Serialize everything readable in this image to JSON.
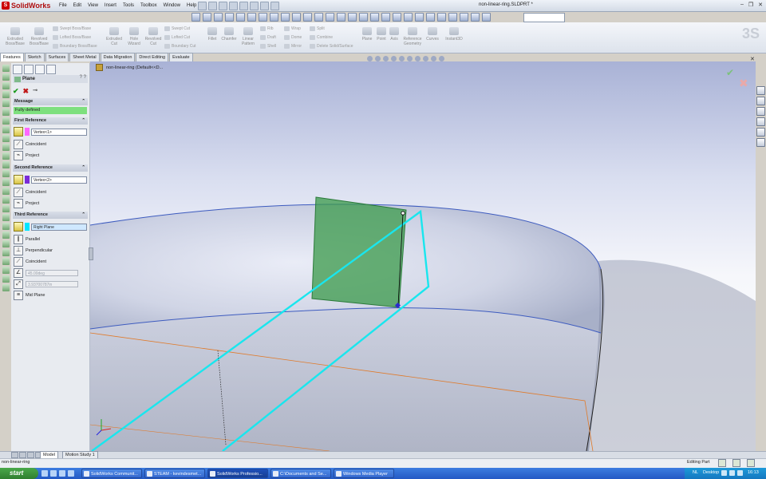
{
  "app": {
    "name": "SolidWorks",
    "doc_title": "non-linear-ring.SLDPRT *"
  },
  "menu": [
    "File",
    "Edit",
    "View",
    "Insert",
    "Tools",
    "Toolbox",
    "Window",
    "Help"
  ],
  "command_manager": {
    "large": [
      {
        "label": "Extruded Boss/Base"
      },
      {
        "label": "Revolved Boss/Base"
      },
      {
        "label": "Extruded Cut"
      },
      {
        "label": "Hole Wizard"
      },
      {
        "label": "Revolved Cut"
      },
      {
        "label": "Fillet"
      },
      {
        "label": "Chamfer"
      },
      {
        "label": "Linear Pattern"
      },
      {
        "label": "Plane"
      },
      {
        "label": "Point"
      },
      {
        "label": "Axis"
      },
      {
        "label": "Reference Geometry"
      },
      {
        "label": "Curves"
      },
      {
        "label": "Instant3D"
      }
    ],
    "small": [
      "Swept Boss/Base",
      "Lofted Boss/Base",
      "Boundary Boss/Base",
      "Swept Cut",
      "Lofted Cut",
      "Boundary Cut",
      "Rib",
      "Draft",
      "Shell",
      "Wrap",
      "Dome",
      "Mirror",
      "Split",
      "Combine",
      "Delete Solid/Surface"
    ]
  },
  "tabs": [
    "Features",
    "Sketch",
    "Surfaces",
    "Sheet Metal",
    "Data Migration",
    "Direct Editing",
    "Evaluate"
  ],
  "tree_path": "non-linear-ring (Default<<D...",
  "property_manager": {
    "title": "Plane",
    "help": "? ?",
    "message_header": "Message",
    "message": "Fully defined",
    "first_ref": {
      "header": "First Reference",
      "value": "Vertex<1>",
      "color": "#ff66ff",
      "options": [
        "Coincident",
        "Project"
      ]
    },
    "second_ref": {
      "header": "Second Reference",
      "value": "Vertex<2>",
      "color": "#7a2cd8",
      "options": [
        "Coincident",
        "Project"
      ]
    },
    "third_ref": {
      "header": "Third Reference",
      "value": "Right Plane",
      "color": "#00e5ff",
      "options": [
        "Parallel",
        "Perpendicular",
        "Coincident"
      ],
      "angle": "45.00deg",
      "distance": "3.93700787in",
      "mid_plane": "Mid Plane"
    }
  },
  "bottom_tabs": [
    "Model",
    "Motion Study 1"
  ],
  "status": {
    "left": "non-linear-ring",
    "right": "Editing Part"
  },
  "taskbar": {
    "start": "start",
    "tasks": [
      "SolidWorks Communit...",
      "STEAM - kevindesmet...",
      "SolidWorks Professio...",
      "C:\\Documents and Se...",
      "Windows Media Player"
    ],
    "active_task": 2,
    "tray": [
      "NL",
      "Desktop"
    ],
    "clock": "16:13"
  },
  "colors": {
    "accent": "#00e5ff",
    "plane": "#3a9a4a",
    "ring": "#8a96b8",
    "message": "#7ee07e"
  }
}
